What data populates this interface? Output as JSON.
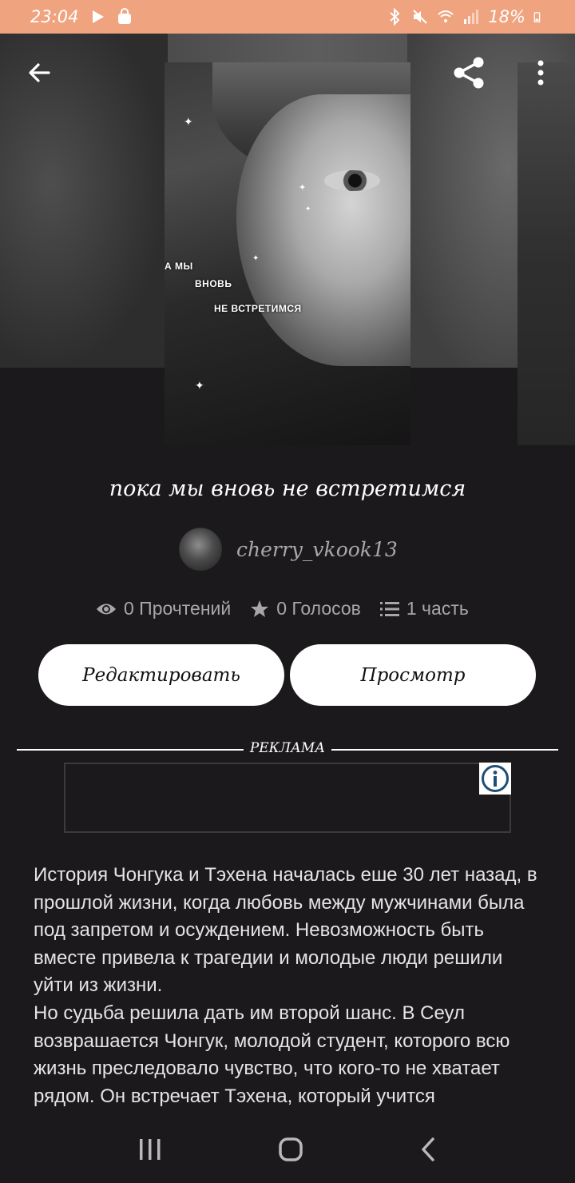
{
  "status_bar": {
    "time": "23:04",
    "battery": "18%"
  },
  "cover": {
    "text_lines": [
      "А МЫ",
      "ВНОВЬ",
      "НЕ ВСТРЕТИМСЯ"
    ]
  },
  "story": {
    "title": "пока мы вновь не встретимся",
    "author": "cherry_vkook13",
    "stats": {
      "reads": "0 Прочтений",
      "votes": "0 Голосов",
      "parts": "1 часть"
    },
    "buttons": {
      "edit": "Редактировать",
      "view": "Просмотр"
    },
    "ad_label": "РЕКЛАМА",
    "description": [
      "История Чонгука и Тэхена началась еше 30 лет назад, в прошлой жизни, когда любовь между мужчинами была под запретом и осуждением. Невозможность быть вместе привела к трагедии и молодые люди решили уйти из жизни.",
      "Но судьба решила дать им второй шанс. В Сеул возврашается Чонгук, молодой студент, которого всю жизнь преследовало чувство, что кого-то не хватает рядом. Он встречает Тэхена, который учится"
    ]
  },
  "icons": {
    "back": "back-arrow-icon",
    "share": "share-icon",
    "more": "more-vertical-icon",
    "reads": "eye-icon",
    "votes": "star-icon",
    "parts": "list-icon",
    "ad_info": "info-icon",
    "nav_recents": "recents-icon",
    "nav_home": "home-icon",
    "nav_back": "nav-back-icon"
  },
  "colors": {
    "status_bar": "#f0a37f",
    "background": "#1b191c",
    "button": "#ffffff",
    "muted_text": "#a7a7a7"
  }
}
